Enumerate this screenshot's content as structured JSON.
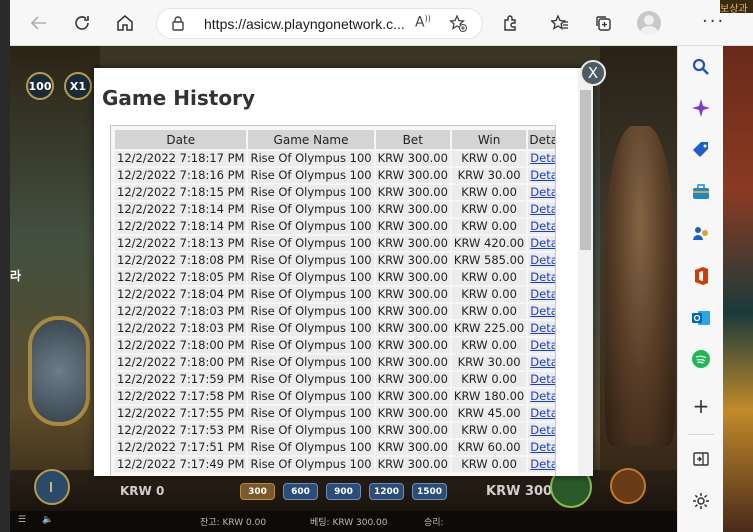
{
  "browser": {
    "url": "https://asicw.playngonetwork.c...",
    "icons": [
      "back-icon",
      "refresh-icon",
      "home-icon",
      "lock-icon",
      "read-aloud-icon",
      "add-favorite-icon",
      "extensions-icon",
      "favorites-icon",
      "collections-icon",
      "profile-avatar",
      "more-icon"
    ]
  },
  "game": {
    "korean_label": "라",
    "zoom_btn_1": "100",
    "zoom_btn_2": "X1",
    "balance_value": "KRW 0",
    "bet_value": "KRW 300",
    "chips": [
      "300",
      "600",
      "900",
      "1200",
      "1500"
    ],
    "status": {
      "balance": "잔고: KRW 0.00",
      "bet": "베팅: KRW 300.00",
      "win": "승리:"
    },
    "topright": "보상과 "
  },
  "modal": {
    "title": "Game History",
    "close_label": "X",
    "columns": [
      "Date",
      "Game Name",
      "Bet",
      "Win",
      ""
    ],
    "details_header": "Details",
    "link_label": "Details",
    "rows": [
      {
        "date": "12/2/2022 7:18:17 PM",
        "game": "Rise Of Olympus 100",
        "bet": "KRW 300.00",
        "win": "KRW 0.00"
      },
      {
        "date": "12/2/2022 7:18:16 PM",
        "game": "Rise Of Olympus 100",
        "bet": "KRW 300.00",
        "win": "KRW 30.00"
      },
      {
        "date": "12/2/2022 7:18:15 PM",
        "game": "Rise Of Olympus 100",
        "bet": "KRW 300.00",
        "win": "KRW 0.00"
      },
      {
        "date": "12/2/2022 7:18:14 PM",
        "game": "Rise Of Olympus 100",
        "bet": "KRW 300.00",
        "win": "KRW 0.00"
      },
      {
        "date": "12/2/2022 7:18:14 PM",
        "game": "Rise Of Olympus 100",
        "bet": "KRW 300.00",
        "win": "KRW 0.00"
      },
      {
        "date": "12/2/2022 7:18:13 PM",
        "game": "Rise Of Olympus 100",
        "bet": "KRW 300.00",
        "win": "KRW 420.00"
      },
      {
        "date": "12/2/2022 7:18:08 PM",
        "game": "Rise Of Olympus 100",
        "bet": "KRW 300.00",
        "win": "KRW 585.00"
      },
      {
        "date": "12/2/2022 7:18:05 PM",
        "game": "Rise Of Olympus 100",
        "bet": "KRW 300.00",
        "win": "KRW 0.00"
      },
      {
        "date": "12/2/2022 7:18:04 PM",
        "game": "Rise Of Olympus 100",
        "bet": "KRW 300.00",
        "win": "KRW 0.00"
      },
      {
        "date": "12/2/2022 7:18:03 PM",
        "game": "Rise Of Olympus 100",
        "bet": "KRW 300.00",
        "win": "KRW 0.00"
      },
      {
        "date": "12/2/2022 7:18:03 PM",
        "game": "Rise Of Olympus 100",
        "bet": "KRW 300.00",
        "win": "KRW 225.00"
      },
      {
        "date": "12/2/2022 7:18:00 PM",
        "game": "Rise Of Olympus 100",
        "bet": "KRW 300.00",
        "win": "KRW 0.00"
      },
      {
        "date": "12/2/2022 7:18:00 PM",
        "game": "Rise Of Olympus 100",
        "bet": "KRW 300.00",
        "win": "KRW 30.00"
      },
      {
        "date": "12/2/2022 7:17:59 PM",
        "game": "Rise Of Olympus 100",
        "bet": "KRW 300.00",
        "win": "KRW 0.00"
      },
      {
        "date": "12/2/2022 7:17:58 PM",
        "game": "Rise Of Olympus 100",
        "bet": "KRW 300.00",
        "win": "KRW 180.00"
      },
      {
        "date": "12/2/2022 7:17:55 PM",
        "game": "Rise Of Olympus 100",
        "bet": "KRW 300.00",
        "win": "KRW 45.00"
      },
      {
        "date": "12/2/2022 7:17:53 PM",
        "game": "Rise Of Olympus 100",
        "bet": "KRW 300.00",
        "win": "KRW 0.00"
      },
      {
        "date": "12/2/2022 7:17:51 PM",
        "game": "Rise Of Olympus 100",
        "bet": "KRW 300.00",
        "win": "KRW 60.00"
      },
      {
        "date": "12/2/2022 7:17:49 PM",
        "game": "Rise Of Olympus 100",
        "bet": "KRW 300.00",
        "win": "KRW 0.00"
      }
    ]
  },
  "sidebar": {
    "items": [
      "search-icon",
      "copilot-icon",
      "shopping-tag-icon",
      "toolbox-icon",
      "people-icon",
      "office-icon",
      "outlook-icon",
      "spotify-icon",
      "add-icon",
      "hide-sidebar-icon",
      "settings-icon"
    ]
  },
  "colors": {
    "link": "#1a3cd6",
    "header_bg": "#d4d4d4",
    "cell_bg": "#ececec"
  }
}
